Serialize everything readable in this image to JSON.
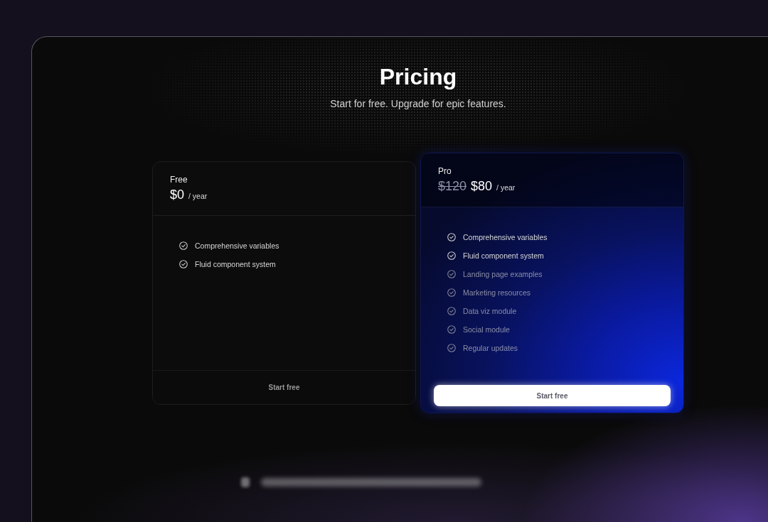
{
  "header": {
    "title": "Pricing",
    "subtitle": "Start for free. Upgrade for epic features."
  },
  "plans": [
    {
      "name": "Free",
      "highlighted": false,
      "price": "$0",
      "period": "/ year",
      "features": [
        {
          "label": "Comprehensive variables",
          "faded": false
        },
        {
          "label": "Fluid component system",
          "faded": false
        }
      ],
      "button": {
        "label": "Start free"
      }
    },
    {
      "name": "Pro",
      "highlighted": true,
      "old_price": "$120",
      "price": "$80",
      "period": "/ year",
      "features": [
        {
          "label": "Comprehensive variables",
          "faded": false
        },
        {
          "label": "Fluid component system",
          "faded": false
        },
        {
          "label": "Landing page examples",
          "faded": true
        },
        {
          "label": "Marketing resources",
          "faded": true
        },
        {
          "label": "Data viz module",
          "faded": true
        },
        {
          "label": "Social module",
          "faded": true
        },
        {
          "label": "Regular updates",
          "faded": true
        }
      ],
      "button": {
        "label": "Start free"
      }
    }
  ]
}
